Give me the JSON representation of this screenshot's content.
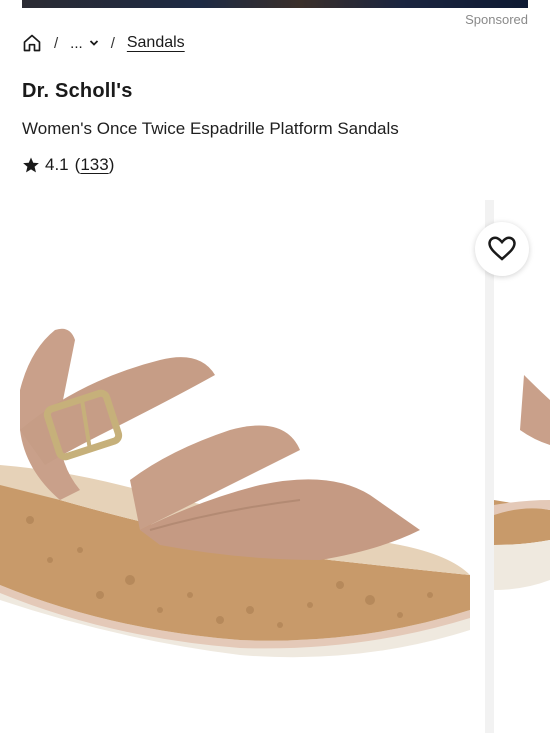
{
  "ad": {
    "sponsored_label": "Sponsored"
  },
  "breadcrumb": {
    "home_icon": "home-icon",
    "separator": "/",
    "more_label": "...",
    "current": "Sandals"
  },
  "product": {
    "brand": "Dr. Scholl's",
    "title": "Women's Once Twice Espadrille Platform Sandals",
    "rating": "4.1",
    "review_count": "133",
    "review_count_open": "(",
    "review_count_close": ")"
  },
  "gallery": {
    "image_alt": "Women's Once Twice Espadrille Platform Sandal in tan leather with cork wedge",
    "favorite_icon": "heart-icon"
  },
  "colors": {
    "strap": "#c9a08a",
    "cork": "#c89a6a",
    "sole": "#efe9df"
  }
}
